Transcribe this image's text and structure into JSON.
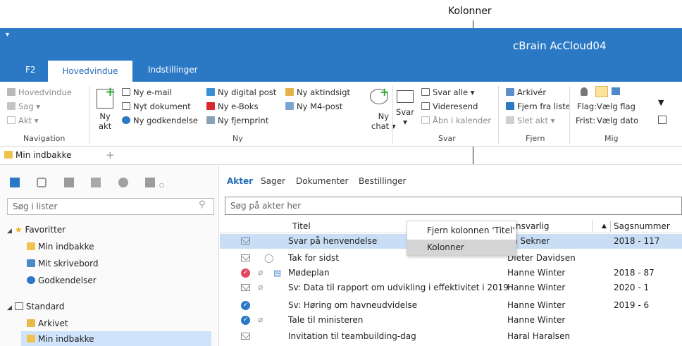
{
  "callout": "Kolonner",
  "app_title": "cBrain AcCloud04",
  "ribbon_tabs": {
    "f2": "F2",
    "hoved": "Hovedvindue",
    "indst": "Indstillinger"
  },
  "ribbon": {
    "nav": {
      "a": "Hovedvindue",
      "b": "Sag ▾",
      "c": "Akt ▾",
      "label": "Navigation"
    },
    "ny_akt": {
      "line1": "Ny",
      "line2": "akt"
    },
    "ny": {
      "a": "Ny e-mail",
      "b": "Nyt dokument",
      "c": "Ny godkendelse",
      "d": "Ny digital post",
      "e": "Ny e-Boks",
      "f": "Ny fjernprint",
      "g": "Ny aktindsigt",
      "h": "Ny M4-post",
      "label": "Ny"
    },
    "ny_chat": {
      "line1": "Ny",
      "line2": "chat ▾"
    },
    "svar": {
      "big1": "Svar",
      "big2": "▾",
      "a": "Svar alle ▾",
      "b": "Videresend",
      "c": "Åbn i kalender",
      "label": "Svar"
    },
    "fjern": {
      "a": "Arkivér",
      "b": "Fjern fra liste",
      "c": "Slet akt ▾",
      "label": "Fjern"
    },
    "mig": {
      "flag_label": "Flag:",
      "flag_value": "Vælg flag",
      "frist_label": "Frist:",
      "frist_value": "Vælg dato",
      "label": "Mig"
    }
  },
  "doc_tab": "Min indbakke",
  "left": {
    "search_placeholder": "Søg i lister",
    "tree": [
      {
        "label": "Favoritter"
      },
      {
        "label": "Min indbakke"
      },
      {
        "label": "Mit skrivebord"
      },
      {
        "label": "Godkendelser"
      },
      {
        "label": "Standard"
      },
      {
        "label": "Arkivet"
      },
      {
        "label": "Min indbakke"
      }
    ]
  },
  "subtabs": [
    "Akter",
    "Sager",
    "Dokumenter",
    "Bestillinger"
  ],
  "right_search_placeholder": "Søg på akter her",
  "columns": {
    "titel": "Titel",
    "ansvarlig": "nsvarlig",
    "sagsnummer": "Sagsnummer"
  },
  "context_menu": {
    "item1": "Fjern kolonnen 'Titel'",
    "item2": "Kolonner"
  },
  "rows": [
    {
      "title": "Svar på henvendelse",
      "owner": "n Sekner",
      "case": "2018 - 117"
    },
    {
      "title": "Tak for sidst",
      "owner": "Dieter Davidsen",
      "case": ""
    },
    {
      "title": "Mødeplan",
      "owner": "Hanne Winter",
      "case": "2018 - 87"
    },
    {
      "title": "Sv: Data til rapport om udvikling i effektivitet i 2019",
      "owner": "Hanne Winter",
      "case": "2020 - 1"
    },
    {
      "title": "Sv: Høring om havneudvidelse",
      "owner": "Hanne Winter",
      "case": "2019 - 6"
    },
    {
      "title": "Tale til ministeren",
      "owner": "Hanne Winter",
      "case": ""
    },
    {
      "title": "Invitation til teambuilding-dag",
      "owner": "Haral Haralsen",
      "case": ""
    }
  ]
}
